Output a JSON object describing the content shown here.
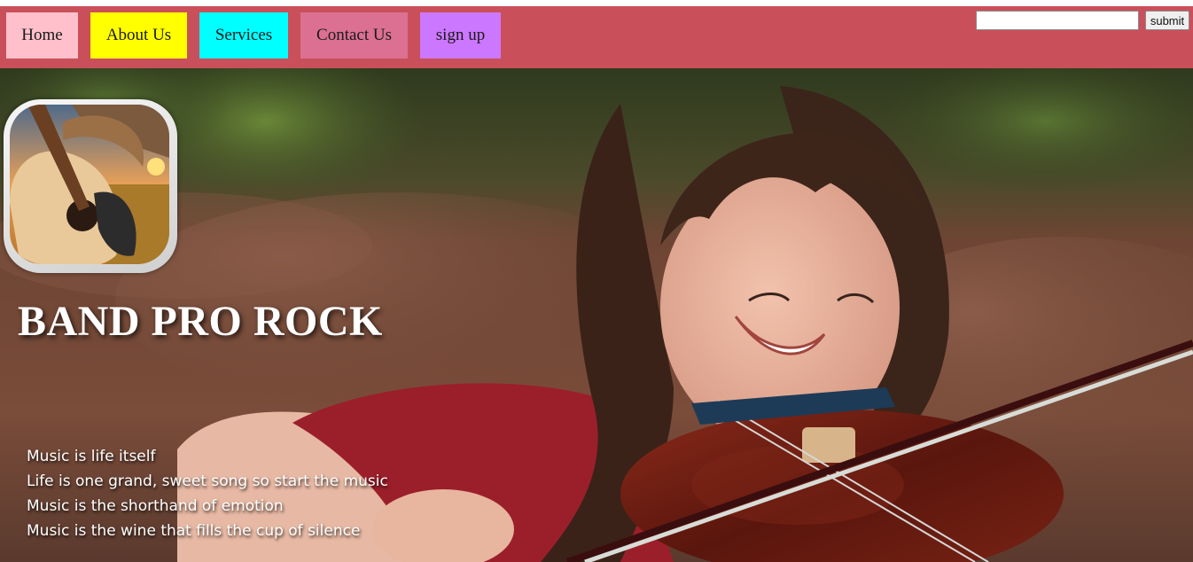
{
  "nav": {
    "items": [
      {
        "label": "Home",
        "color": "#ffc0cb"
      },
      {
        "label": "About Us",
        "color": "#ffff00"
      },
      {
        "label": "Services",
        "color": "#00ffff"
      },
      {
        "label": "Contact Us",
        "color": "#db7093"
      },
      {
        "label": "sign up",
        "color": "#cc77ff"
      }
    ],
    "bar_color": "#c9505a"
  },
  "search": {
    "value": "",
    "submit_label": "submit"
  },
  "hero": {
    "title": "BAND PRO ROCK",
    "quotes": [
      "Music is life itself",
      "Life is one grand, sweet song so start the music",
      "Music is the shorthand of emotion",
      "Music is the wine that fills the cup of silence"
    ],
    "logo_icon": "guitar-icon"
  }
}
